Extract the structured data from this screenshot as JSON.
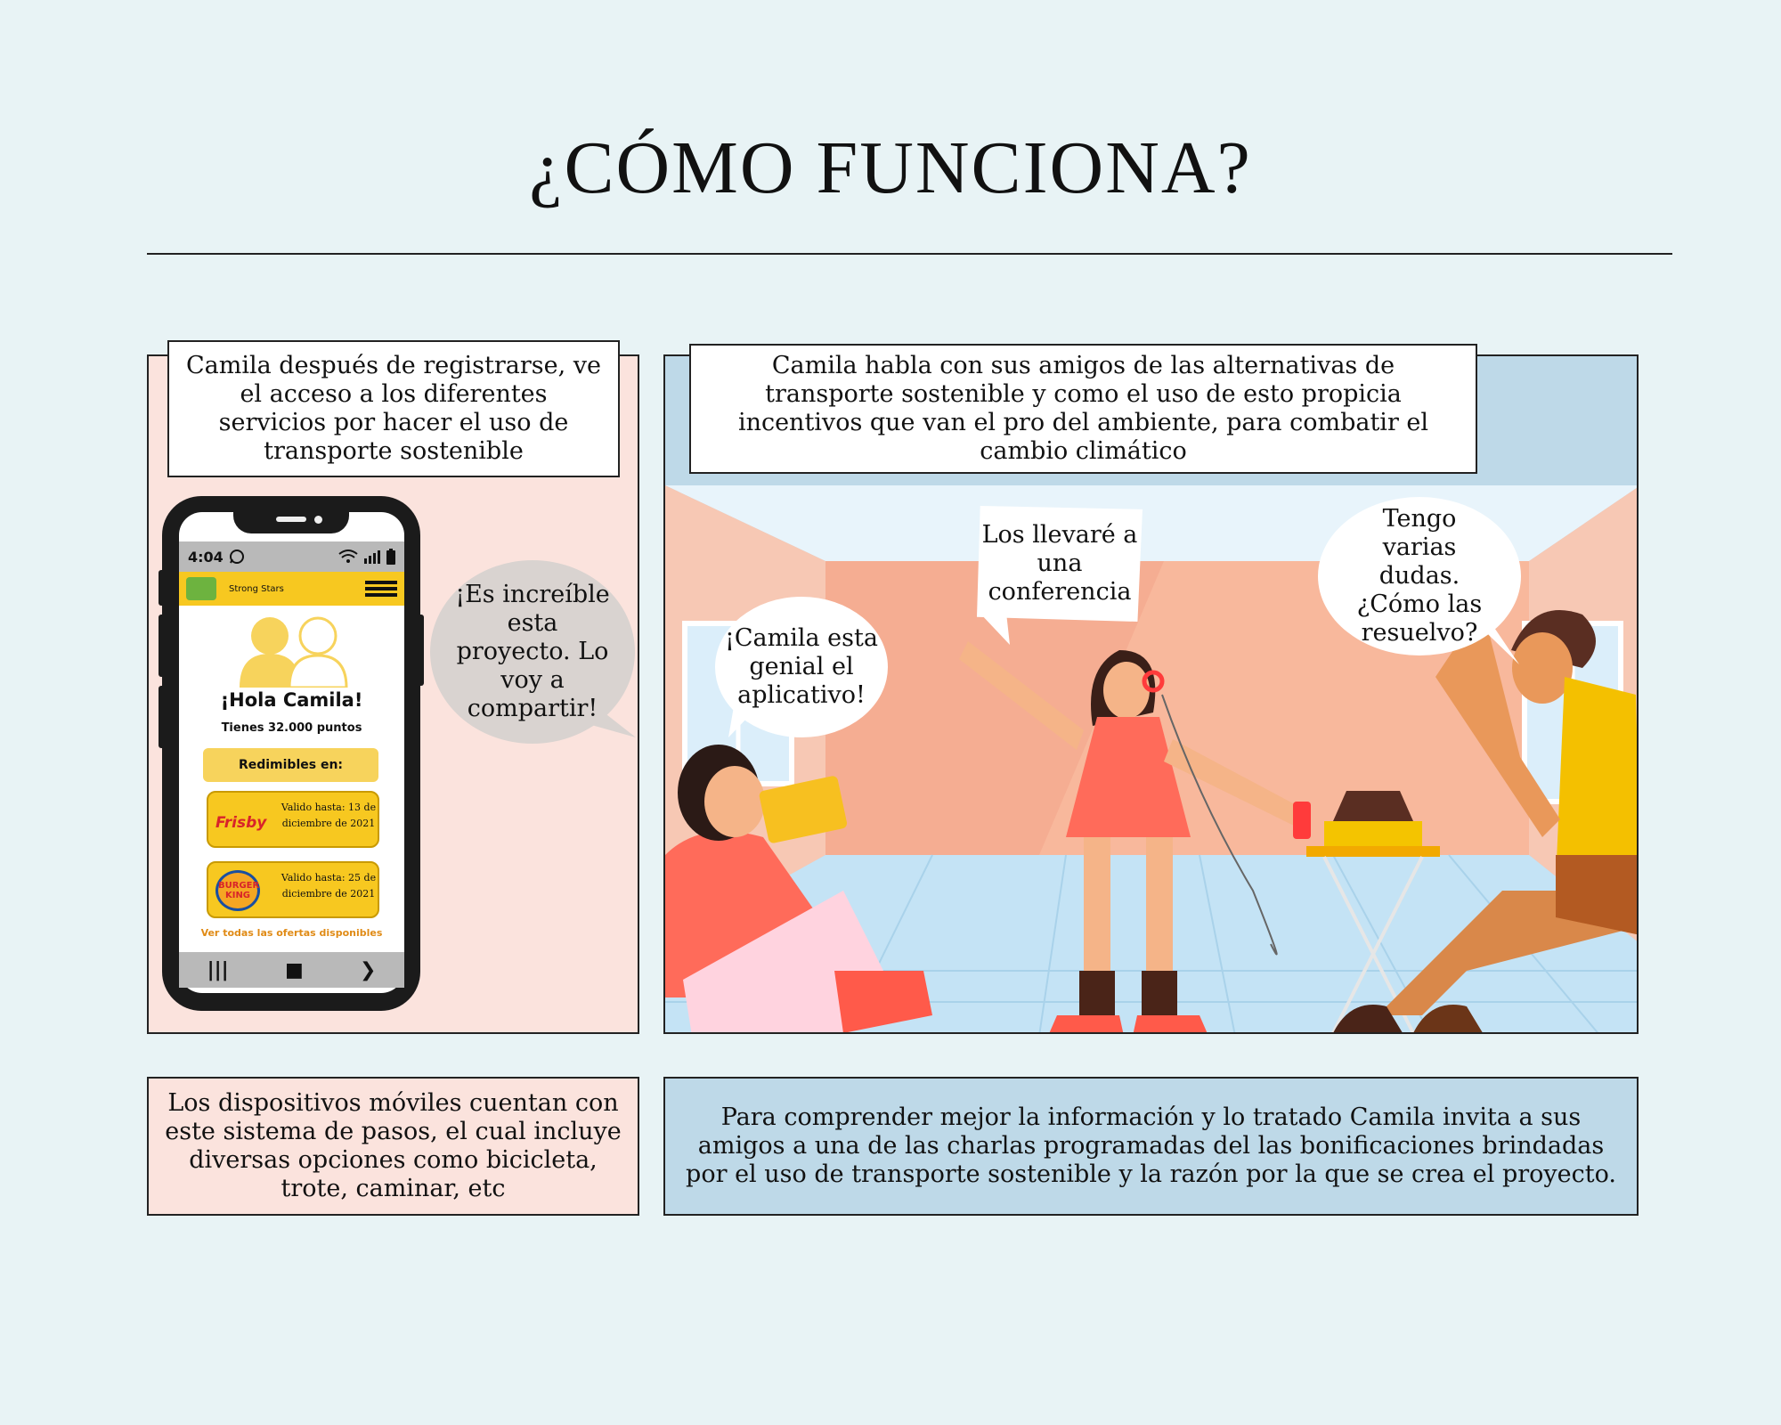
{
  "page": {
    "title": "¿CÓMO FUNCIONA?"
  },
  "panel_left": {
    "caption": "Camila después de registrarse, ve el acceso a los diferentes servicios por hacer el uso de transporte sostenible",
    "bubble": "¡Es increíble esta proyecto. Lo voy a compartir!",
    "bottom": "Los dispositivos móviles cuentan con este sistema de pasos, el cual incluye diversas opciones como bicicleta, trote, caminar, etc"
  },
  "phone": {
    "time": "4:04",
    "app_name": "Strong Stars",
    "greeting": "¡Hola Camila!",
    "points": "Tienes 32.000 puntos",
    "redeem_label": "Redimibles en:",
    "coupons": [
      {
        "brand": "Frisby",
        "valid": "Valido hasta: 13 de diciembre de 2021"
      },
      {
        "brand": "BURGER KING",
        "valid": "Valido hasta: 25 de diciembre de 2021"
      }
    ],
    "offers_link": "Ver todas las ofertas disponibles",
    "nav": [
      "|||",
      "■",
      "❯"
    ]
  },
  "panel_right": {
    "caption": "Camila habla con sus amigos de las alternativas de transporte sostenible y como el uso de esto propicia incentivos que van el pro del ambiente, para combatir el cambio climático",
    "bubble_1": "¡Camila esta genial el aplicativo!",
    "bubble_2": "Los llevaré a una conferencia",
    "bubble_3": "Tengo varias dudas. ¿Cómo las resuelvo?",
    "bottom": "Para comprender mejor la información y lo tratado Camila invita a sus amigos a una de las charlas programadas del las bonificaciones brindadas por el uso de transporte sostenible y la razón por la que se crea el proyecto."
  },
  "colors": {
    "background": "#e8f3f5",
    "left_panel": "#fbe3dd",
    "right_panel": "#bed9e8",
    "app_yellow": "#f7c820"
  }
}
